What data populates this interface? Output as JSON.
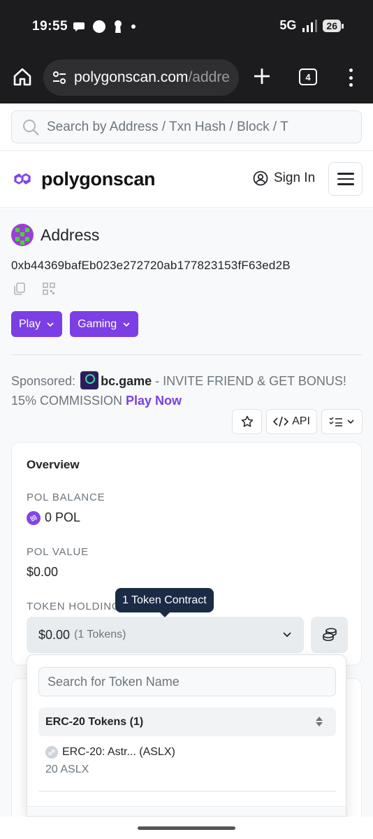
{
  "status_bar": {
    "time": "19:55",
    "network": "5G",
    "battery": "26"
  },
  "browser": {
    "url_main": "polygonscan.com",
    "url_path": "/addre",
    "tab_count": "4"
  },
  "search": {
    "placeholder": "Search by Address / Txn Hash / Block / T"
  },
  "header": {
    "brand": "polygonscan",
    "sign_in": "Sign In"
  },
  "address": {
    "title": "Address",
    "hash": "0xb44369bafEb023e272720ab177823153fF63ed2B",
    "tags": [
      "Play",
      "Gaming"
    ]
  },
  "sponsored": {
    "label": "Sponsored:",
    "brand": "bc.game",
    "text": " - INVITE FRIEND & GET BONUS! 15% COMMISSION ",
    "cta": "Play Now"
  },
  "toolbar": {
    "api_label": "API"
  },
  "overview": {
    "title": "Overview",
    "balance_label": "POL BALANCE",
    "balance_value": "0 POL",
    "value_label": "POL VALUE",
    "value_value": "$0.00",
    "holding_label": "TOKEN HOLDING",
    "holding_value": "$0.00",
    "holding_count": "(1 Tokens)"
  },
  "tooltip": {
    "text": "1 Token Contract"
  },
  "dropdown": {
    "search_placeholder": "Search for Token Name",
    "group_label": "ERC-20 Tokens (1)",
    "items": [
      {
        "name": "ERC-20: Astr... (ASLX)",
        "amount": "20 ASLX"
      }
    ]
  },
  "colors": {
    "brand_purple": "#7b3fe4",
    "tooltip_bg": "#1b2b45"
  }
}
